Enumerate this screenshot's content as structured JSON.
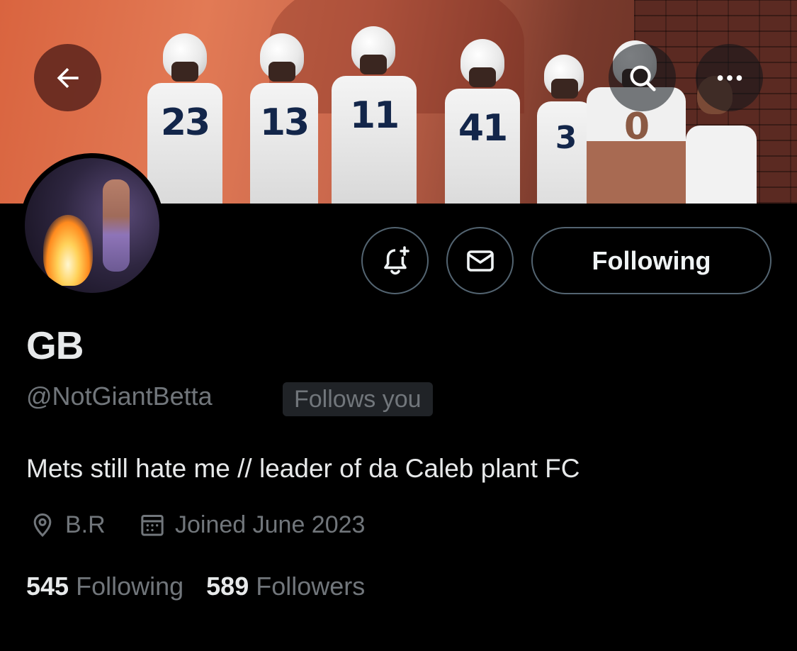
{
  "profile": {
    "display_name": "GB",
    "handle": "@NotGiantBetta",
    "follows_you_badge": "Follows you",
    "bio": "Mets still hate me // leader of da Caleb plant FC",
    "location": "B.R",
    "joined": "Joined June 2023"
  },
  "banner": {
    "jersey_numbers": [
      "23",
      "13",
      "11",
      "41",
      "3",
      "0"
    ]
  },
  "actions": {
    "follow_state_label": "Following"
  },
  "stats": {
    "following_count": "545",
    "following_label": "Following",
    "followers_count": "589",
    "followers_label": "Followers"
  },
  "icons": {
    "back": "arrow-left-icon",
    "search": "search-icon",
    "more": "more-horizontal-icon",
    "notify": "bell-plus-icon",
    "message": "envelope-icon",
    "location": "location-pin-icon",
    "calendar": "calendar-icon"
  },
  "colors": {
    "background": "#000000",
    "primary_text": "#e7e9ea",
    "secondary_text": "#71767b",
    "border": "#536471",
    "badge_bg": "#202327"
  }
}
